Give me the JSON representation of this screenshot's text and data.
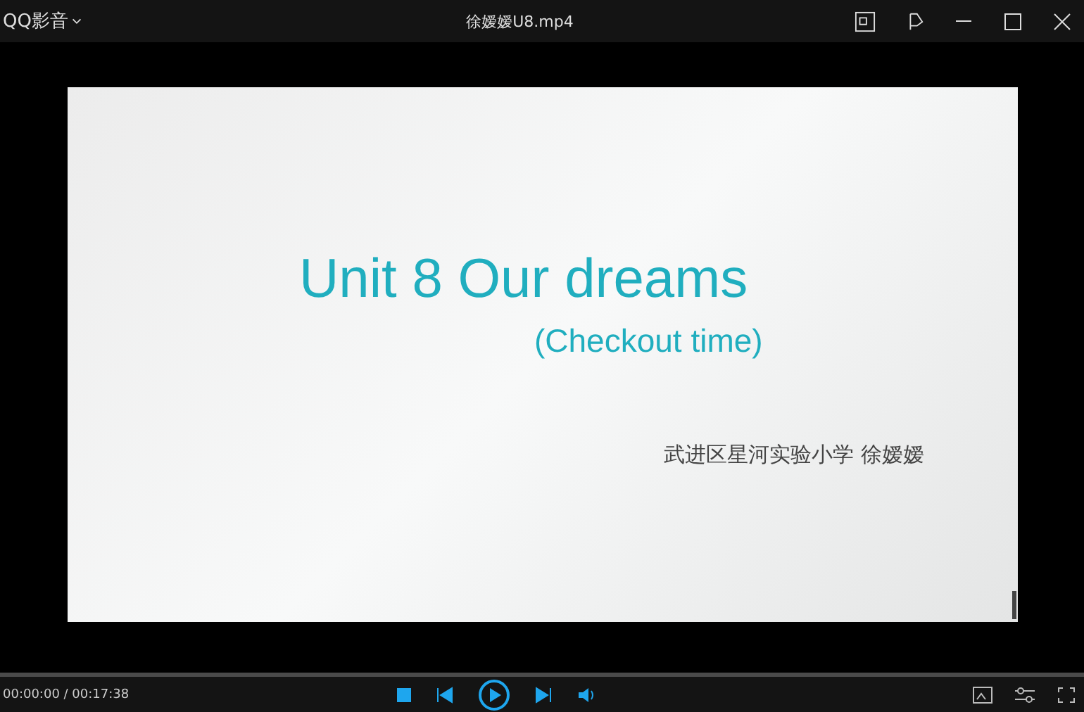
{
  "window": {
    "app_menu": "QQ影音",
    "title": "徐嫒嫒U8.mp4"
  },
  "slide": {
    "title": "Unit 8 Our dreams",
    "subtitle": "(Checkout time)",
    "author": "武进区星河实验小学 徐嫒嫒"
  },
  "progress": {
    "level": 0
  },
  "controls": {
    "time": "00:00:00 / 00:17:38"
  }
}
